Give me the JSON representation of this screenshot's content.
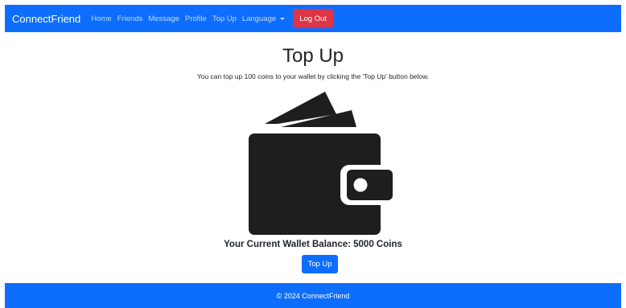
{
  "navbar": {
    "brand": "ConnectFriend",
    "links": [
      "Home",
      "Friends",
      "Message",
      "Profile",
      "Top Up"
    ],
    "language_label": "Language",
    "logout_label": "Log Out"
  },
  "main": {
    "title": "Top Up",
    "subtitle": "You can top up 100 coins to your wallet by clicking the 'Top Up' button below.",
    "wallet_icon": "wallet-icon",
    "balance_text": "Your Current Wallet Balance: 5000 Coins",
    "topup_label": "Top Up"
  },
  "footer": {
    "text": "© 2024 ConnectFriend"
  },
  "colors": {
    "primary": "#0d6efd",
    "danger": "#dc3545",
    "icon": "#1e1e1e"
  }
}
